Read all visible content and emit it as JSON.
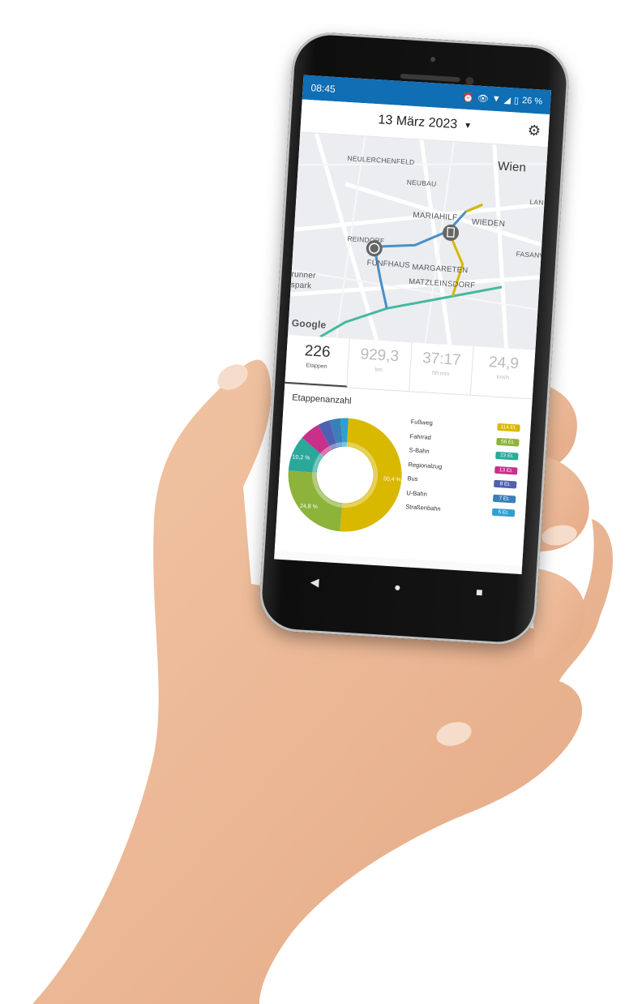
{
  "statusbar": {
    "time": "08:45",
    "battery": "26 %"
  },
  "header": {
    "date": "13 März 2023",
    "dropdown_icon": "caret-down-icon",
    "settings_icon": "gear-icon"
  },
  "map": {
    "labels": [
      "NEULERCHENFELD",
      "Wien",
      "NEUBAU",
      "MARIAHILF",
      "WIEDEN",
      "REINDORF",
      "FÜNFHAUS",
      "MARGARETEN",
      "MATZLEINSDORF",
      "FASANVIE",
      "LAN",
      "runner",
      "spark"
    ],
    "attribution": "Google"
  },
  "stats": [
    {
      "value": "226",
      "unit": "Etappen"
    },
    {
      "value": "929,3",
      "unit": "km"
    },
    {
      "value": "37:17",
      "unit": "hh:mm"
    },
    {
      "value": "24,9",
      "unit": "km/h"
    }
  ],
  "chart_title": "Etappenanzahl",
  "chart_data": {
    "type": "pie",
    "categories": [
      "Fußweg",
      "Fahrrad",
      "S-Bahn",
      "Regionalzug",
      "Bus",
      "U-Bahn",
      "Straßenbahn"
    ],
    "values": [
      114,
      56,
      23,
      13,
      8,
      7,
      5
    ],
    "badges": [
      "114 Et.",
      "56 Et.",
      "23 Et.",
      "13 Et.",
      "8 Et.",
      "7 Et.",
      "5 Et."
    ],
    "percent_labels": [
      "50,4 %",
      "24,8 %",
      "10,2 %"
    ],
    "colors": [
      "#d9b800",
      "#8db33a",
      "#2aa89a",
      "#c8308a",
      "#5060b0",
      "#3a7fb8",
      "#2ea0d0"
    ]
  },
  "nav": {
    "back": "◀",
    "home": "●",
    "recent": "■"
  }
}
